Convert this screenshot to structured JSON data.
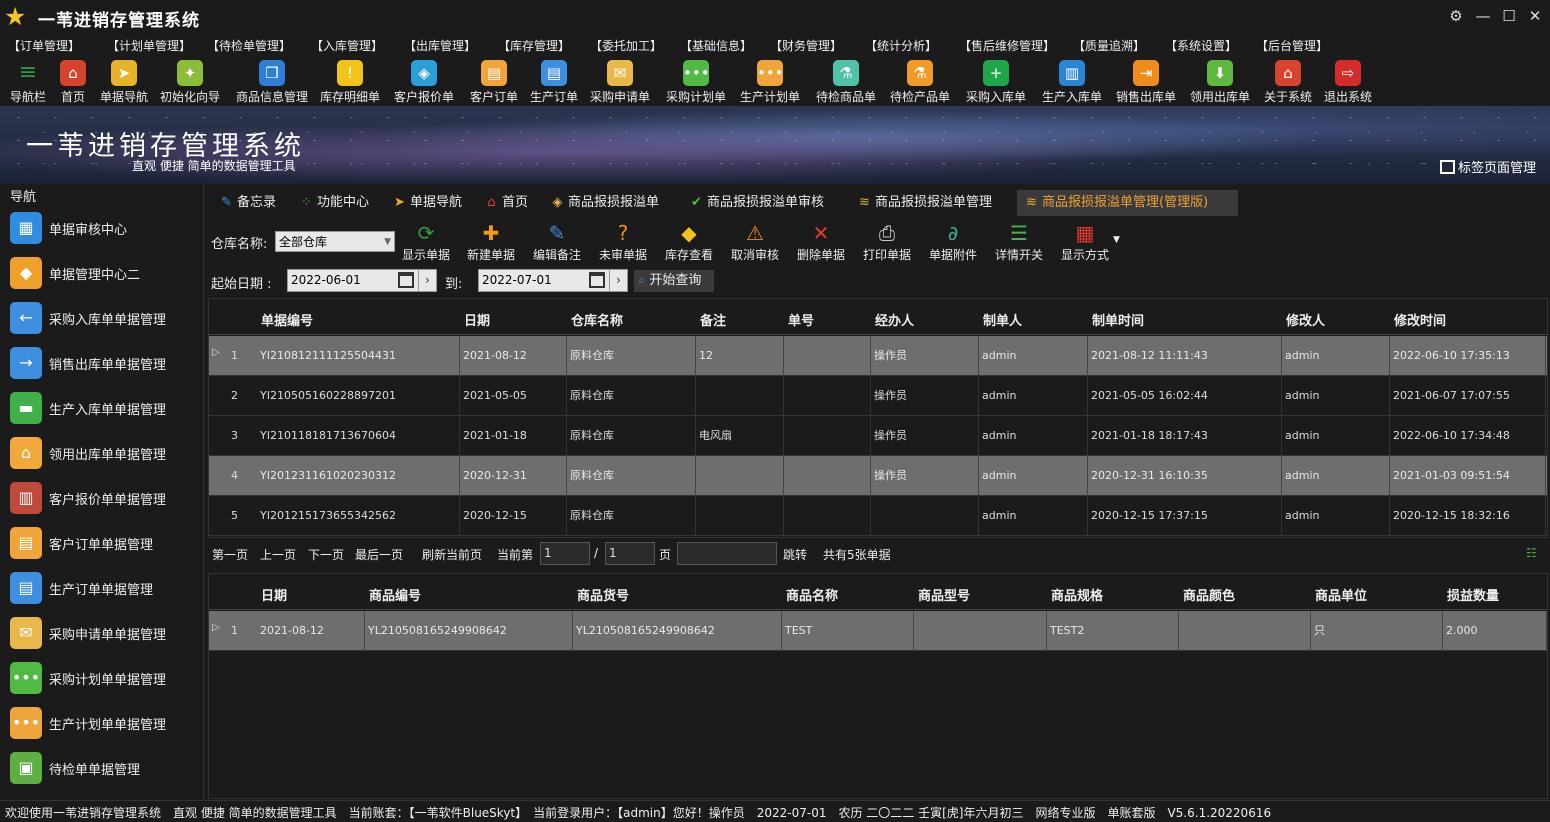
{
  "app": {
    "title": "一苇进销存管理系统"
  },
  "menu": [
    "【订单管理】",
    "【计划单管理】",
    "【待检单管理】",
    "【入库管理】",
    "【出库管理】",
    "【库存管理】",
    "【委托加工】",
    "【基础信息】",
    "【财务管理】",
    "【统计分析】",
    "【售后维修管理】",
    "【质量追溯】",
    "【系统设置】",
    "【后台管理】"
  ],
  "toolbar": [
    {
      "label": "导航栏",
      "icon": "menu-icon",
      "color": "#2e9c3a"
    },
    {
      "label": "首页",
      "icon": "home-icon",
      "color": "#d8432f"
    },
    {
      "label": "单据导航",
      "icon": "pointer-icon",
      "color": "#e7b128"
    },
    {
      "label": "初始化向导",
      "icon": "wand-icon",
      "color": "#8bbd3a"
    },
    {
      "label": "商品信息管理",
      "icon": "cubes-icon",
      "color": "#2f7fd6"
    },
    {
      "label": "库存明细单",
      "icon": "warning-icon",
      "color": "#f2c318"
    },
    {
      "label": "客户报价单",
      "icon": "tag-icon",
      "color": "#2a9fd8"
    },
    {
      "label": "客户订单",
      "icon": "doc-orange-icon",
      "color": "#f1a43a"
    },
    {
      "label": "生产订单",
      "icon": "doc-blue-icon",
      "color": "#3f8fe0"
    },
    {
      "label": "采购申请单",
      "icon": "envelope-icon",
      "color": "#e9b84a"
    },
    {
      "label": "采购计划单",
      "icon": "chat-green-icon",
      "color": "#52b947"
    },
    {
      "label": "生产计划单",
      "icon": "chat-orange-icon",
      "color": "#f0a53b"
    },
    {
      "label": "待检商品单",
      "icon": "flask-icon",
      "color": "#4fc2a8"
    },
    {
      "label": "待检产品单",
      "icon": "beaker-icon",
      "color": "#f19b2c"
    },
    {
      "label": "采购入库单",
      "icon": "plus-circle-icon",
      "color": "#1fa64a"
    },
    {
      "label": "生产入库单",
      "icon": "barcode-icon",
      "color": "#2a86d0"
    },
    {
      "label": "销售出库单",
      "icon": "export-icon",
      "color": "#f08c1c"
    },
    {
      "label": "领用出库单",
      "icon": "download-icon",
      "color": "#5fb83e"
    },
    {
      "label": "关于系统",
      "icon": "house-icon",
      "color": "#d8432f"
    },
    {
      "label": "退出系统",
      "icon": "exit-icon",
      "color": "#d42b2b"
    }
  ],
  "banner": {
    "title": "一苇进销存管理系统",
    "subtitle": "直观 便捷 简单的数据管理工具",
    "tab_manager": "标签页面管理"
  },
  "sidebar": {
    "title": "导航",
    "items": [
      {
        "label": "单据审核中心",
        "icon": "grid-icon",
        "color": "#2f8ce0"
      },
      {
        "label": "单据管理中心二",
        "icon": "grid-orange-icon",
        "color": "#f0a02c"
      },
      {
        "label": "采购入库单单据管理",
        "icon": "arrow-left-icon",
        "color": "#3f8fe0"
      },
      {
        "label": "销售出库单单据管理",
        "icon": "arrow-right-icon",
        "color": "#3f8fe0"
      },
      {
        "label": "生产入库单单据管理",
        "icon": "folder-icon",
        "color": "#3fb04a"
      },
      {
        "label": "领用出库单单据管理",
        "icon": "box-icon",
        "color": "#f2a93b"
      },
      {
        "label": "客户报价单单据管理",
        "icon": "books-icon",
        "color": "#c0493a"
      },
      {
        "label": "客户订单单据管理",
        "icon": "doc-orange-icon",
        "color": "#f1a43a"
      },
      {
        "label": "生产订单单据管理",
        "icon": "doc-blue-icon",
        "color": "#3f8fe0"
      },
      {
        "label": "采购申请单单据管理",
        "icon": "envelope-icon",
        "color": "#e9b84a"
      },
      {
        "label": "采购计划单单据管理",
        "icon": "chat-green-icon",
        "color": "#52b947"
      },
      {
        "label": "生产计划单单据管理",
        "icon": "chat-orange-icon",
        "color": "#f0a53b"
      },
      {
        "label": "待检单单据管理",
        "icon": "clipboard-icon",
        "color": "#5fae42"
      }
    ]
  },
  "tabs": [
    {
      "label": "备忘录",
      "icon": "memo-icon"
    },
    {
      "label": "功能中心",
      "icon": "apps-icon"
    },
    {
      "label": "单据导航",
      "icon": "pointer-icon"
    },
    {
      "label": "首页",
      "icon": "home-icon"
    },
    {
      "label": "商品报损报溢单",
      "icon": "tag-icon"
    },
    {
      "label": "商品报损报溢单审核",
      "icon": "check-icon"
    },
    {
      "label": "商品报损报溢单管理",
      "icon": "stack-icon"
    },
    {
      "label": "商品报损报溢单管理(管理版)",
      "icon": "stack-icon",
      "active": true
    }
  ],
  "filter": {
    "warehouse_label": "仓库名称:",
    "warehouse_value": "全部仓库",
    "start_label": "起始日期 :",
    "start_value": "2022-06-01",
    "to_label": "到:",
    "end_value": "2022-07-01",
    "search_label": "开始查询"
  },
  "actions": [
    {
      "label": "显示单据",
      "icon": "refresh-icon",
      "color": "#2ea043",
      "glyph": "⟳"
    },
    {
      "label": "新建单据",
      "icon": "plus-icon",
      "color": "#f39c12",
      "glyph": "✚"
    },
    {
      "label": "编辑备注",
      "icon": "edit-icon",
      "color": "#3f8fe0",
      "glyph": "✎"
    },
    {
      "label": "未审单据",
      "icon": "question-icon",
      "color": "#f08c1c",
      "glyph": "?"
    },
    {
      "label": "库存查看",
      "icon": "cube-icon",
      "color": "#f2c318",
      "glyph": "◆"
    },
    {
      "label": "取消审核",
      "icon": "warning-icon",
      "color": "#f08c1c",
      "glyph": "⚠"
    },
    {
      "label": "删除单据",
      "icon": "delete-icon",
      "color": "#e23a2f",
      "glyph": "✕"
    },
    {
      "label": "打印单据",
      "icon": "printer-icon",
      "color": "#cccccc",
      "glyph": "⎙"
    },
    {
      "label": "单据附件",
      "icon": "paperclip-icon",
      "color": "#35b5a0",
      "glyph": "∂"
    },
    {
      "label": "详情开关",
      "icon": "list-icon",
      "color": "#4caf50",
      "glyph": "☰"
    },
    {
      "label": "显示方式",
      "icon": "tiles-icon",
      "color": "#e23a2f",
      "glyph": "▦"
    }
  ],
  "master": {
    "columns": [
      "单据编号",
      "日期",
      "仓库名称",
      "备注",
      "单号",
      "经办人",
      "制单人",
      "制单时间",
      "修改人",
      "修改时间"
    ],
    "rows": [
      {
        "n": "1",
        "sel": true,
        "cells": [
          "YI210812111125504431",
          "2021-08-12",
          "原料仓库",
          "12",
          "",
          "操作员",
          "admin",
          "2021-08-12 11:11:43",
          "admin",
          "2022-06-10 17:35:13"
        ]
      },
      {
        "n": "2",
        "sel": false,
        "cells": [
          "YI210505160228897201",
          "2021-05-05",
          "原料仓库",
          "",
          "",
          "操作员",
          "admin",
          "2021-05-05 16:02:44",
          "admin",
          "2021-06-07 17:07:55"
        ]
      },
      {
        "n": "3",
        "sel": false,
        "cells": [
          "YI210118181713670604",
          "2021-01-18",
          "原料仓库",
          "电风扇",
          "",
          "操作员",
          "admin",
          "2021-01-18 18:17:43",
          "admin",
          "2022-06-10 17:34:48"
        ]
      },
      {
        "n": "4",
        "sel": true,
        "cells": [
          "YI201231161020230312",
          "2020-12-31",
          "原料仓库",
          "",
          "",
          "操作员",
          "admin",
          "2020-12-31 16:10:35",
          "admin",
          "2021-01-03 09:51:54"
        ]
      },
      {
        "n": "5",
        "sel": false,
        "cells": [
          "YI201215173655342562",
          "2020-12-15",
          "原料仓库",
          "",
          "",
          "",
          "admin",
          "2020-12-15 17:37:15",
          "admin",
          "2020-12-15 18:32:16"
        ]
      }
    ]
  },
  "pager": {
    "first": "第一页",
    "prev": "上一页",
    "next": "下一页",
    "last": "最后一页",
    "refresh": "刷新当前页",
    "current_label": "当前第",
    "current": "1",
    "sep": "/",
    "total_pages": "1",
    "page_label": "页",
    "jump": "跳转",
    "total": "共有5张单据"
  },
  "detail": {
    "columns": [
      "日期",
      "商品编号",
      "商品货号",
      "商品名称",
      "商品型号",
      "商品规格",
      "商品颜色",
      "商品单位",
      "损益数量"
    ],
    "rows": [
      {
        "n": "1",
        "sel": true,
        "cells": [
          "2021-08-12",
          "YL210508165249908642",
          "YL210508165249908642",
          "TEST",
          "",
          "TEST2",
          "",
          "只",
          "2.000"
        ]
      }
    ]
  },
  "status": "欢迎使用一苇进销存管理系统　直观 便捷 简单的数据管理工具　当前账套：【一苇软件BlueSkyt】　当前登录用户：【admin】您好！操作员　2022-07-01　农历 二〇二二 壬寅[虎]年六月初三　网络专业版　单账套版　V5.6.1.20220616"
}
